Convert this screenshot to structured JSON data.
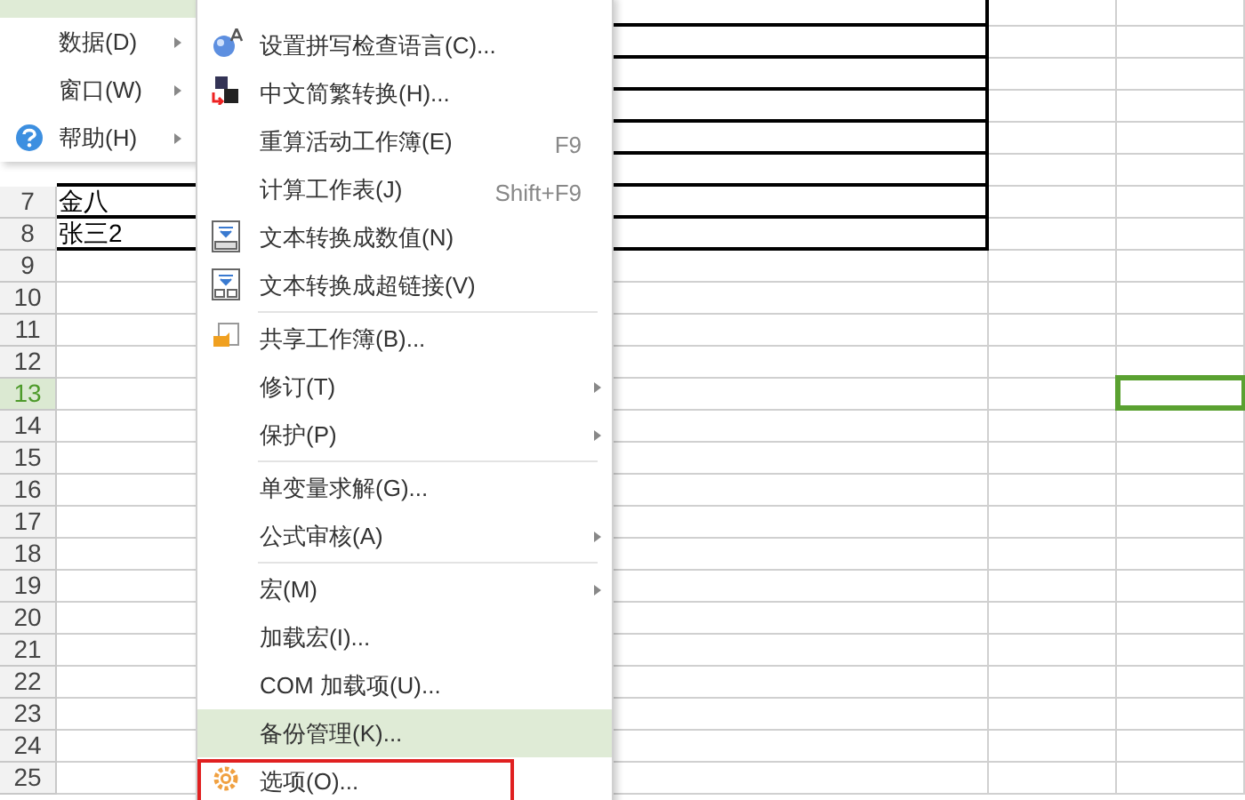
{
  "sheet": {
    "rows": [
      {
        "bordered": true
      },
      {
        "bordered": true
      },
      {
        "bordered": true
      },
      {
        "bordered": true
      },
      {
        "bordered": true
      },
      {
        "bordered": true
      },
      {
        "header": "7",
        "cells": [
          "金八"
        ],
        "bordered": true,
        "selected": false
      },
      {
        "header": "8",
        "cells": [
          "张三2"
        ],
        "bordered": true,
        "selected": false
      },
      {
        "header": "9",
        "bordered": false,
        "selected": false
      },
      {
        "header": "10",
        "bordered": false,
        "selected": false
      },
      {
        "header": "11",
        "bordered": false,
        "selected": false
      },
      {
        "header": "12",
        "bordered": false,
        "selected": false
      },
      {
        "header": "13",
        "bordered": false,
        "selected": true
      },
      {
        "header": "14",
        "bordered": false,
        "selected": false
      },
      {
        "header": "15",
        "bordered": false,
        "selected": false
      },
      {
        "header": "16",
        "bordered": false,
        "selected": false
      },
      {
        "header": "17",
        "bordered": false,
        "selected": false
      },
      {
        "header": "18",
        "bordered": false,
        "selected": false
      },
      {
        "header": "19",
        "bordered": false,
        "selected": false
      },
      {
        "header": "20",
        "bordered": false,
        "selected": false
      },
      {
        "header": "21",
        "bordered": false,
        "selected": false
      },
      {
        "header": "22",
        "bordered": false,
        "selected": false
      },
      {
        "header": "23",
        "bordered": false,
        "selected": false
      },
      {
        "header": "24",
        "bordered": false,
        "selected": false
      },
      {
        "header": "25",
        "bordered": false,
        "selected": false
      }
    ]
  },
  "main_menu": {
    "items": [
      {
        "selected": true
      },
      {
        "label": "数据(D)",
        "kind": "plain",
        "selected": false
      },
      {
        "label": "窗口(W)",
        "kind": "plain",
        "selected": false
      },
      {
        "label": "帮助(H)",
        "kind": "help",
        "selected": false
      }
    ]
  },
  "submenu": {
    "items": [
      {
        "kind": "language",
        "label": "设置拼写检查语言(C)...",
        "has_submenu": false,
        "selected": false,
        "outlined": false
      },
      {
        "kind": "convert",
        "label": "中文简繁转换(H)...",
        "has_submenu": false,
        "selected": false,
        "outlined": false
      },
      {
        "kind": "item",
        "label": "重算活动工作簿(E)",
        "shortcut": "F9",
        "has_submenu": false,
        "selected": false,
        "outlined": false
      },
      {
        "kind": "item",
        "label": "计算工作表(J)",
        "shortcut": "Shift+F9",
        "has_submenu": false,
        "selected": false,
        "outlined": false
      },
      {
        "kind": "number",
        "label": "文本转换成数值(N)",
        "has_submenu": false,
        "selected": false,
        "outlined": false
      },
      {
        "kind": "hyperlink",
        "label": "文本转换成超链接(V)",
        "has_submenu": false,
        "selected": false,
        "outlined": false
      },
      {
        "kind": "separator"
      },
      {
        "kind": "share",
        "label": "共享工作簿(B)...",
        "has_submenu": false,
        "selected": false,
        "outlined": false
      },
      {
        "kind": "item",
        "label": "修订(T)",
        "has_submenu": true,
        "selected": false,
        "outlined": false
      },
      {
        "kind": "item",
        "label": "保护(P)",
        "has_submenu": true,
        "selected": false,
        "outlined": false
      },
      {
        "kind": "separator"
      },
      {
        "kind": "item",
        "label": "单变量求解(G)...",
        "has_submenu": false,
        "selected": false,
        "outlined": false
      },
      {
        "kind": "item",
        "label": "公式审核(A)",
        "has_submenu": true,
        "selected": false,
        "outlined": false
      },
      {
        "kind": "separator"
      },
      {
        "kind": "item",
        "label": "宏(M)",
        "has_submenu": true,
        "selected": false,
        "outlined": false
      },
      {
        "kind": "item",
        "label": "加载宏(I)...",
        "has_submenu": false,
        "selected": false,
        "outlined": false
      },
      {
        "kind": "item",
        "label": "COM 加载项(U)...",
        "has_submenu": false,
        "selected": false,
        "outlined": false
      },
      {
        "kind": "item",
        "label": "备份管理(K)...",
        "has_submenu": false,
        "selected": true,
        "outlined": false
      },
      {
        "kind": "gear",
        "label": "选项(O)...",
        "has_submenu": false,
        "selected": false,
        "outlined": true
      }
    ]
  }
}
